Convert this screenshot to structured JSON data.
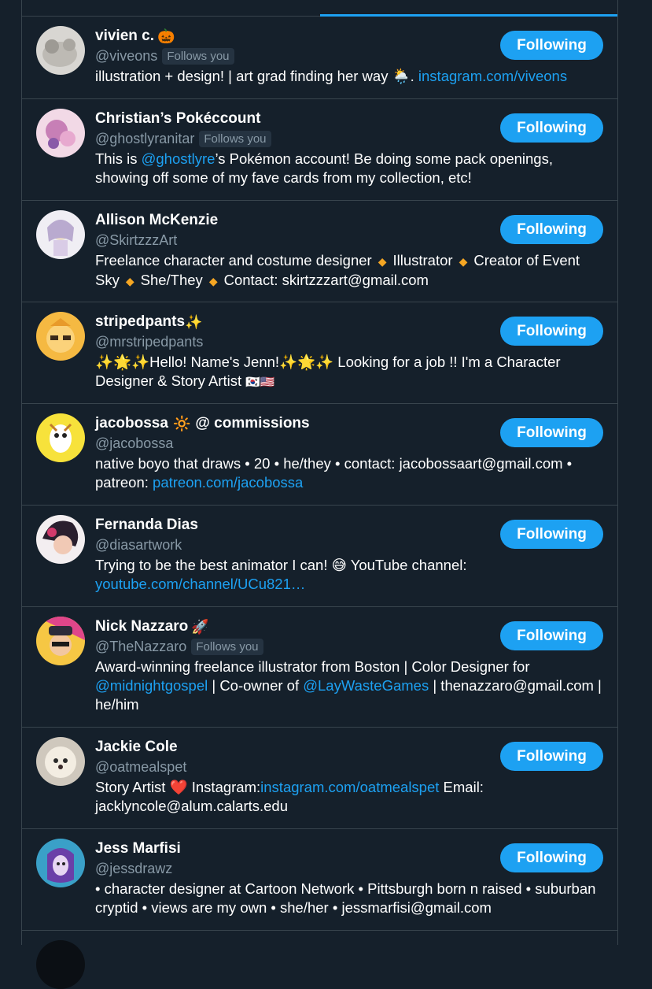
{
  "follow_label": "Following",
  "follows_you_label": "Follows you",
  "colors": {
    "accent": "#1da1f2",
    "background": "#15202b",
    "border": "#38444d",
    "secondary_text": "#8899a6"
  },
  "users": [
    {
      "name": "vivien c.",
      "name_emoji": "🎃",
      "handle": "@viveons",
      "follows_you": true,
      "bio": {
        "text": "illustration + design! | art grad finding her way 🌦️. ",
        "link": "instagram.com/viveons"
      }
    },
    {
      "name": "Christian’s Pokéccount",
      "handle": "@ghostlyranitar",
      "follows_you": true,
      "bio": {
        "pre": "This is ",
        "mention": "@ghostlyre",
        "post": "’s Pokémon account! Be doing some pack openings, showing off some of my fave cards from my collection, etc!"
      }
    },
    {
      "name": "Allison McKenzie",
      "handle": "@SkirtzzzArt",
      "follows_you": false,
      "bio": {
        "parts": [
          "Freelance character and costume designer",
          "Illustrator",
          "Creator of Event Sky",
          "She/They",
          "Contact: skirtzzzart@gmail.com"
        ]
      }
    },
    {
      "name": "stripedpants",
      "name_emoji": "✨",
      "handle": "@mrstripedpants",
      "follows_you": false,
      "bio": {
        "text": "✨🌟✨Hello! Name's Jenn!✨🌟✨ Looking for a job !! I'm a Character Designer & Story Artist ",
        "flags": "🇰🇷🇺🇸"
      }
    },
    {
      "name": "jacobossa",
      "name_emoji": "🔆",
      "name_suffix": "@ commissions",
      "handle": "@jacobossa",
      "follows_you": false,
      "bio": {
        "text": "native boyo that draws • 20 • he/they • contact: jacobossaart@gmail.com • patreon: ",
        "link": "patreon.com/jacobossa"
      }
    },
    {
      "name": "Fernanda Dias",
      "handle": "@diasartwork",
      "follows_you": false,
      "bio": {
        "text": "Trying to be the best animator I can! 😅 YouTube channel: ",
        "link": "youtube.com/channel/UCu821…"
      }
    },
    {
      "name": "Nick Nazzaro",
      "name_emoji": "🚀",
      "handle": "@TheNazzaro",
      "follows_you": true,
      "bio": {
        "pre": "Award-winning freelance illustrator from Boston | Color Designer for ",
        "mention1": "@midnightgospel",
        "mid": " | Co-owner of ",
        "mention2": "@LayWasteGames",
        "post": " | thenazzaro@gmail.com | he/him"
      }
    },
    {
      "name": "Jackie Cole",
      "handle": "@oatmealspet",
      "follows_you": false,
      "bio": {
        "pre": "Story Artist ❤️ Instagram:",
        "link": "instagram.com/oatmealspet",
        "post": " Email: jacklyncole@alum.calarts.edu"
      }
    },
    {
      "name": "Jess Marfisi",
      "handle": "@jessdrawz",
      "follows_you": false,
      "bio": {
        "text": "• character designer at Cartoon Network • Pittsburgh born n raised • suburban cryptid • views are my own • she/her • jessmarfisi@gmail.com"
      }
    }
  ]
}
